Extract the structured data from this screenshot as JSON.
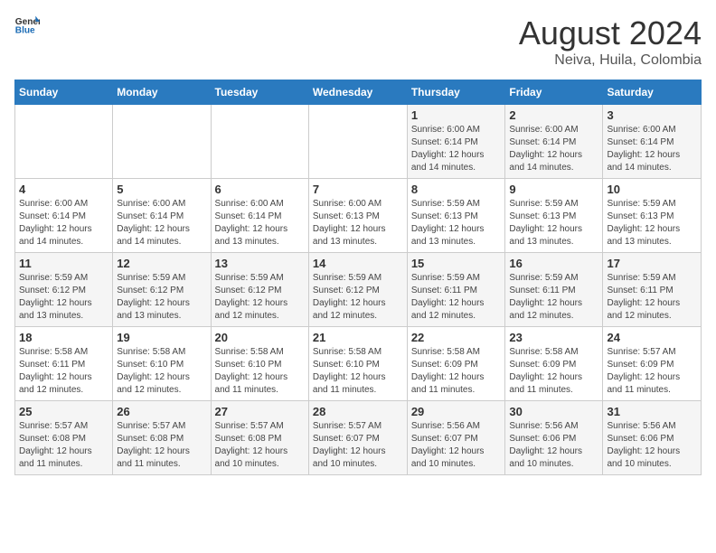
{
  "header": {
    "logo_general": "General",
    "logo_blue": "Blue",
    "title": "August 2024",
    "subtitle": "Neiva, Huila, Colombia"
  },
  "weekdays": [
    "Sunday",
    "Monday",
    "Tuesday",
    "Wednesday",
    "Thursday",
    "Friday",
    "Saturday"
  ],
  "weeks": [
    [
      {
        "day": "",
        "info": ""
      },
      {
        "day": "",
        "info": ""
      },
      {
        "day": "",
        "info": ""
      },
      {
        "day": "",
        "info": ""
      },
      {
        "day": "1",
        "info": "Sunrise: 6:00 AM\nSunset: 6:14 PM\nDaylight: 12 hours\nand 14 minutes."
      },
      {
        "day": "2",
        "info": "Sunrise: 6:00 AM\nSunset: 6:14 PM\nDaylight: 12 hours\nand 14 minutes."
      },
      {
        "day": "3",
        "info": "Sunrise: 6:00 AM\nSunset: 6:14 PM\nDaylight: 12 hours\nand 14 minutes."
      }
    ],
    [
      {
        "day": "4",
        "info": "Sunrise: 6:00 AM\nSunset: 6:14 PM\nDaylight: 12 hours\nand 14 minutes."
      },
      {
        "day": "5",
        "info": "Sunrise: 6:00 AM\nSunset: 6:14 PM\nDaylight: 12 hours\nand 14 minutes."
      },
      {
        "day": "6",
        "info": "Sunrise: 6:00 AM\nSunset: 6:14 PM\nDaylight: 12 hours\nand 13 minutes."
      },
      {
        "day": "7",
        "info": "Sunrise: 6:00 AM\nSunset: 6:13 PM\nDaylight: 12 hours\nand 13 minutes."
      },
      {
        "day": "8",
        "info": "Sunrise: 5:59 AM\nSunset: 6:13 PM\nDaylight: 12 hours\nand 13 minutes."
      },
      {
        "day": "9",
        "info": "Sunrise: 5:59 AM\nSunset: 6:13 PM\nDaylight: 12 hours\nand 13 minutes."
      },
      {
        "day": "10",
        "info": "Sunrise: 5:59 AM\nSunset: 6:13 PM\nDaylight: 12 hours\nand 13 minutes."
      }
    ],
    [
      {
        "day": "11",
        "info": "Sunrise: 5:59 AM\nSunset: 6:12 PM\nDaylight: 12 hours\nand 13 minutes."
      },
      {
        "day": "12",
        "info": "Sunrise: 5:59 AM\nSunset: 6:12 PM\nDaylight: 12 hours\nand 13 minutes."
      },
      {
        "day": "13",
        "info": "Sunrise: 5:59 AM\nSunset: 6:12 PM\nDaylight: 12 hours\nand 12 minutes."
      },
      {
        "day": "14",
        "info": "Sunrise: 5:59 AM\nSunset: 6:12 PM\nDaylight: 12 hours\nand 12 minutes."
      },
      {
        "day": "15",
        "info": "Sunrise: 5:59 AM\nSunset: 6:11 PM\nDaylight: 12 hours\nand 12 minutes."
      },
      {
        "day": "16",
        "info": "Sunrise: 5:59 AM\nSunset: 6:11 PM\nDaylight: 12 hours\nand 12 minutes."
      },
      {
        "day": "17",
        "info": "Sunrise: 5:59 AM\nSunset: 6:11 PM\nDaylight: 12 hours\nand 12 minutes."
      }
    ],
    [
      {
        "day": "18",
        "info": "Sunrise: 5:58 AM\nSunset: 6:11 PM\nDaylight: 12 hours\nand 12 minutes."
      },
      {
        "day": "19",
        "info": "Sunrise: 5:58 AM\nSunset: 6:10 PM\nDaylight: 12 hours\nand 12 minutes."
      },
      {
        "day": "20",
        "info": "Sunrise: 5:58 AM\nSunset: 6:10 PM\nDaylight: 12 hours\nand 11 minutes."
      },
      {
        "day": "21",
        "info": "Sunrise: 5:58 AM\nSunset: 6:10 PM\nDaylight: 12 hours\nand 11 minutes."
      },
      {
        "day": "22",
        "info": "Sunrise: 5:58 AM\nSunset: 6:09 PM\nDaylight: 12 hours\nand 11 minutes."
      },
      {
        "day": "23",
        "info": "Sunrise: 5:58 AM\nSunset: 6:09 PM\nDaylight: 12 hours\nand 11 minutes."
      },
      {
        "day": "24",
        "info": "Sunrise: 5:57 AM\nSunset: 6:09 PM\nDaylight: 12 hours\nand 11 minutes."
      }
    ],
    [
      {
        "day": "25",
        "info": "Sunrise: 5:57 AM\nSunset: 6:08 PM\nDaylight: 12 hours\nand 11 minutes."
      },
      {
        "day": "26",
        "info": "Sunrise: 5:57 AM\nSunset: 6:08 PM\nDaylight: 12 hours\nand 11 minutes."
      },
      {
        "day": "27",
        "info": "Sunrise: 5:57 AM\nSunset: 6:08 PM\nDaylight: 12 hours\nand 10 minutes."
      },
      {
        "day": "28",
        "info": "Sunrise: 5:57 AM\nSunset: 6:07 PM\nDaylight: 12 hours\nand 10 minutes."
      },
      {
        "day": "29",
        "info": "Sunrise: 5:56 AM\nSunset: 6:07 PM\nDaylight: 12 hours\nand 10 minutes."
      },
      {
        "day": "30",
        "info": "Sunrise: 5:56 AM\nSunset: 6:06 PM\nDaylight: 12 hours\nand 10 minutes."
      },
      {
        "day": "31",
        "info": "Sunrise: 5:56 AM\nSunset: 6:06 PM\nDaylight: 12 hours\nand 10 minutes."
      }
    ]
  ]
}
